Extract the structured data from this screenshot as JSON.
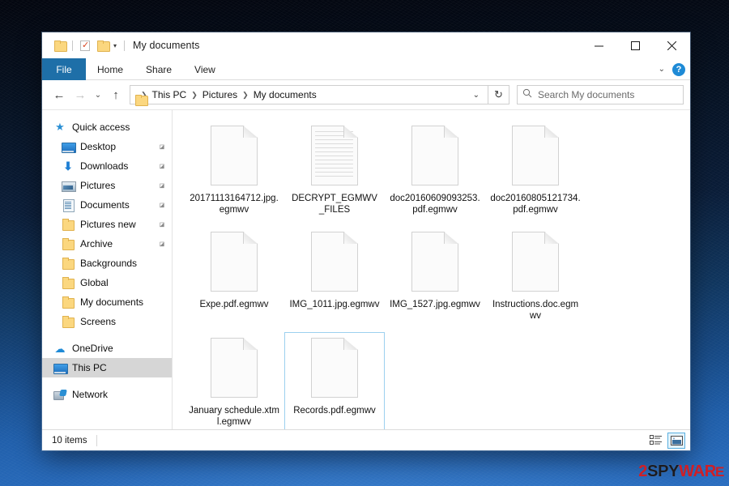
{
  "window": {
    "title": "My documents",
    "quick_access": [
      {
        "name": "folder-icon",
        "label": "Folder"
      },
      {
        "name": "properties-icon",
        "label": "Properties"
      },
      {
        "name": "new-folder-icon",
        "label": "New folder"
      }
    ],
    "qat_caret": "▾",
    "controls": {
      "minimize": "—",
      "maximize": "□",
      "close": "✕"
    }
  },
  "ribbon": {
    "tabs": [
      {
        "label": "File",
        "active": true
      },
      {
        "label": "Home",
        "active": false
      },
      {
        "label": "Share",
        "active": false
      },
      {
        "label": "View",
        "active": false
      }
    ],
    "expand_caret": "⌄",
    "help_label": "?"
  },
  "address": {
    "back": "←",
    "forward": "→",
    "history": "⌄",
    "up": "↑",
    "breadcrumbs": [
      "This PC",
      "Pictures",
      "My documents"
    ],
    "separator": "❯",
    "dropdown_caret": "⌄",
    "refresh": "↻"
  },
  "search": {
    "placeholder": "Search My documents",
    "icon": "search-icon"
  },
  "sidebar": {
    "items": [
      {
        "label": "Quick access",
        "icon": "star-icon",
        "indent": false,
        "pinned": false,
        "selected": false
      },
      {
        "label": "Desktop",
        "icon": "desktop-icon",
        "indent": true,
        "pinned": true,
        "selected": false
      },
      {
        "label": "Downloads",
        "icon": "download-icon",
        "indent": true,
        "pinned": true,
        "selected": false
      },
      {
        "label": "Pictures",
        "icon": "pictures-icon",
        "indent": true,
        "pinned": true,
        "selected": false
      },
      {
        "label": "Documents",
        "icon": "documents-icon",
        "indent": true,
        "pinned": true,
        "selected": false
      },
      {
        "label": "Pictures new",
        "icon": "folder-icon",
        "indent": true,
        "pinned": true,
        "selected": false
      },
      {
        "label": "Archive",
        "icon": "folder-icon",
        "indent": true,
        "pinned": true,
        "selected": false
      },
      {
        "label": "Backgrounds",
        "icon": "folder-icon",
        "indent": true,
        "pinned": false,
        "selected": false
      },
      {
        "label": "Global",
        "icon": "folder-icon",
        "indent": true,
        "pinned": false,
        "selected": false
      },
      {
        "label": "My documents",
        "icon": "folder-icon",
        "indent": true,
        "pinned": false,
        "selected": false
      },
      {
        "label": "Screens",
        "icon": "folder-icon",
        "indent": true,
        "pinned": false,
        "selected": false
      }
    ],
    "roots": [
      {
        "label": "OneDrive",
        "icon": "cloud-icon",
        "selected": false
      },
      {
        "label": "This PC",
        "icon": "computer-icon",
        "selected": true
      },
      {
        "label": "Network",
        "icon": "network-icon",
        "selected": false
      }
    ],
    "pin_glyph": "📌"
  },
  "files": [
    {
      "name": "20171113164712.jpg.egmwv",
      "icon": "blank-document-icon",
      "selected": false
    },
    {
      "name": "DECRYPT_EGMWV_FILES",
      "icon": "text-document-icon",
      "selected": false
    },
    {
      "name": "doc20160609093253.pdf.egmwv",
      "icon": "blank-document-icon",
      "selected": false
    },
    {
      "name": "doc20160805121734.pdf.egmwv",
      "icon": "blank-document-icon",
      "selected": false
    },
    {
      "name": "Expe.pdf.egmwv",
      "icon": "blank-document-icon",
      "selected": false
    },
    {
      "name": "IMG_1011.jpg.egmwv",
      "icon": "blank-document-icon",
      "selected": false
    },
    {
      "name": "IMG_1527.jpg.egmwv",
      "icon": "blank-document-icon",
      "selected": false
    },
    {
      "name": "Instructions.doc.egmwv",
      "icon": "blank-document-icon",
      "selected": false
    },
    {
      "name": "January schedule.xtml.egmwv",
      "icon": "blank-document-icon",
      "selected": false
    },
    {
      "name": "Records.pdf.egmwv",
      "icon": "blank-document-icon",
      "selected": true
    }
  ],
  "statusbar": {
    "item_count": "10 items",
    "views": [
      {
        "name": "details-view-button",
        "active": false
      },
      {
        "name": "large-icons-view-button",
        "active": true
      }
    ]
  },
  "watermark": {
    "part1": "2",
    "part2": "SPY",
    "part3": "WAR",
    "part4": "E"
  },
  "colors": {
    "accent": "#1e6fa8",
    "selection_border": "#9cd0ef",
    "folder_yellow": "#fbd77f",
    "watermark_red": "#cf1f26"
  }
}
